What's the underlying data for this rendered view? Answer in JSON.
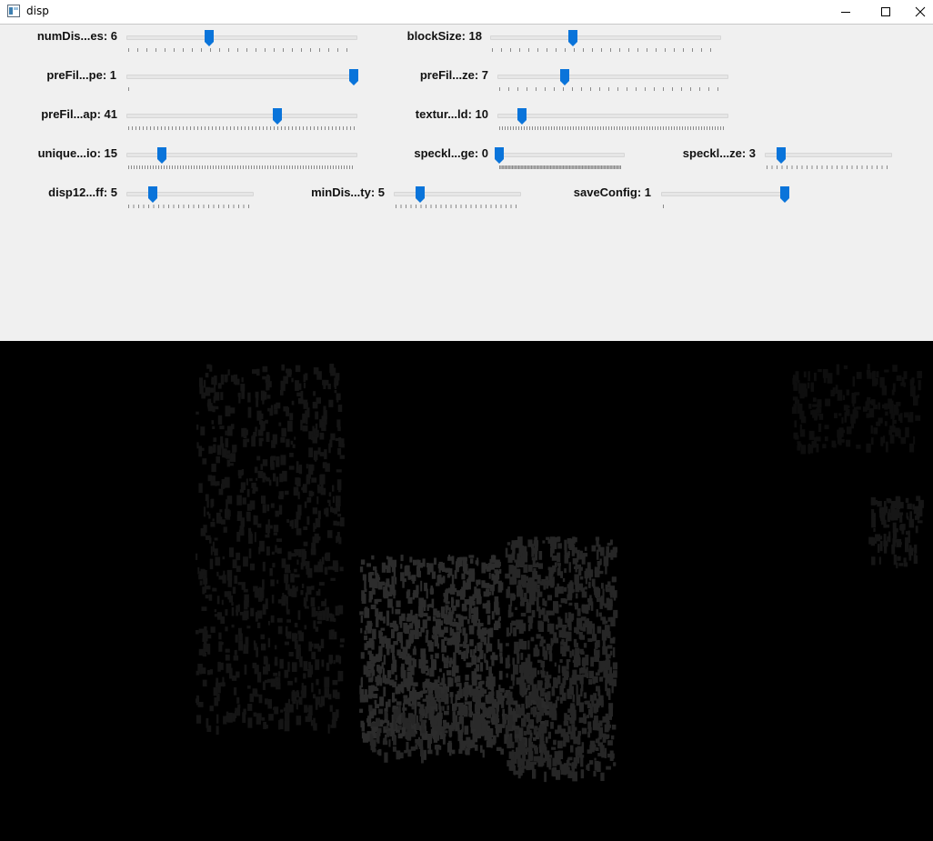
{
  "window": {
    "title": "disp",
    "icon": "app-window-icon",
    "buttons": {
      "minimize": "minimize-icon",
      "maximize": "maximize-icon",
      "close": "close-icon"
    }
  },
  "colors": {
    "thumb": "#0a74da",
    "panel": "#f0f0f0",
    "track": "#e6e6e6",
    "disparity_background": "#000000",
    "disparity_blobs": "#2a2a2a"
  },
  "trackbars": [
    {
      "label": "numDis...es: 6",
      "value": 6,
      "max": 16,
      "fraction": 0.36
    },
    {
      "label": "blockSize: 18",
      "value": 18,
      "max": 50,
      "fraction": 0.36
    },
    {
      "label": "preFil...pe: 1",
      "value": 1,
      "max": 1,
      "fraction": 1.0
    },
    {
      "label": "preFil...ze: 7",
      "value": 7,
      "max": 25,
      "fraction": 0.29
    },
    {
      "label": "preFil...ap: 41",
      "value": 41,
      "max": 62,
      "fraction": 0.66
    },
    {
      "label": "textur...ld: 10",
      "value": 10,
      "max": 100,
      "fraction": 0.1
    },
    {
      "label": "unique...io: 15",
      "value": 15,
      "max": 100,
      "fraction": 0.15
    },
    {
      "label": "speckl...ge: 0",
      "value": 0,
      "max": 100,
      "fraction": 0.0
    },
    {
      "label": "speckl...ze: 3",
      "value": 3,
      "max": 25,
      "fraction": 0.12
    },
    {
      "label": "disp12...ff: 5",
      "value": 5,
      "max": 25,
      "fraction": 0.2
    },
    {
      "label": "minDis...ty: 5",
      "value": 5,
      "max": 25,
      "fraction": 0.2
    },
    {
      "label": "saveConfig: 1",
      "value": 1,
      "max": 1,
      "fraction": 1.0
    }
  ]
}
